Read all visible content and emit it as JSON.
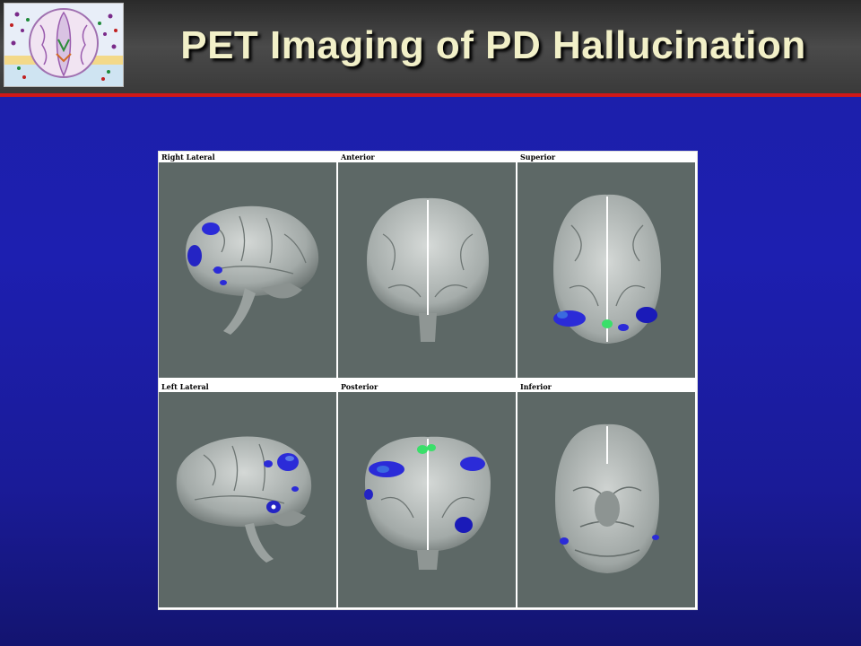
{
  "slide": {
    "title": "PET Imaging of PD Hallucination",
    "logo_icon": "brain-section-logo-icon",
    "colors": {
      "background": "#1c1fa8",
      "header": "#3a3a3a",
      "rule": "#d01818",
      "title_text": "#f2f0c8",
      "panel_bg": "#5d6866",
      "activation_blue": "#2b2bd8",
      "activation_green": "#3adf6a"
    }
  },
  "figure": {
    "panels": [
      {
        "label": "Right Lateral",
        "icon": "brain-right-lateral-icon"
      },
      {
        "label": "Anterior",
        "icon": "brain-anterior-icon"
      },
      {
        "label": "Superior",
        "icon": "brain-superior-icon"
      },
      {
        "label": "Left Lateral",
        "icon": "brain-left-lateral-icon"
      },
      {
        "label": "Posterior",
        "icon": "brain-posterior-icon"
      },
      {
        "label": "Inferior",
        "icon": "brain-inferior-icon"
      }
    ]
  }
}
